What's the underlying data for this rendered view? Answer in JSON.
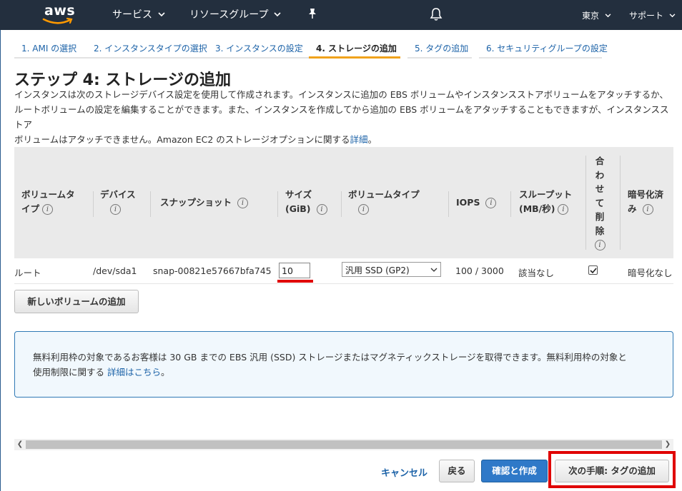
{
  "topnav": {
    "logo_text": "aws",
    "services_label": "サービス",
    "resource_groups_label": "リソースグループ",
    "region_label": "東京",
    "support_label": "サポート",
    "icons": [
      "pin-icon",
      "bell-icon",
      "chevron-down-icon"
    ]
  },
  "wizard": {
    "tabs": [
      {
        "label": "1. AMI の選択"
      },
      {
        "label": "2. インスタンスタイプの選択"
      },
      {
        "label": "3. インスタンスの設定"
      },
      {
        "label": "4. ストレージの追加",
        "active": true
      },
      {
        "label": "5. タグの追加"
      },
      {
        "label": "6. セキュリティグループの設定"
      }
    ]
  },
  "page": {
    "title": "ステップ 4: ストレージの追加",
    "description_line1": "インスタンスは次のストレージデバイス設定を使用して作成されます。インスタンスに追加の EBS ボリュームやインスタンスストアボリュームをアタッチするか、",
    "description_line2": "ルートボリュームの設定を編集することができます。また、インスタンスを作成してから追加の EBS ボリュームをアタッチすることもできますが、インスタンスストア",
    "description_line3": "ボリュームはアタッチできません。Amazon EC2 のストレージオプションに関する",
    "description_link": "詳細",
    "description_end": "。"
  },
  "storage_table": {
    "headers": {
      "volume_type": [
        "ボリュームタ",
        "イプ"
      ],
      "device": [
        "デバイス"
      ],
      "snapshot": [
        "スナップショット"
      ],
      "size": [
        "サイズ",
        "(GiB)"
      ],
      "volume_kind": [
        "ボリュームタイプ"
      ],
      "iops": [
        "IOPS"
      ],
      "throughput": [
        "スループット",
        "(MB/秒)"
      ],
      "delete_on_termination": [
        "合",
        "わ",
        "せ",
        "て",
        "削",
        "除"
      ],
      "encryption": [
        "暗号化済",
        "み"
      ]
    },
    "row": {
      "volume_type": "ルート",
      "device": "/dev/sda1",
      "snapshot": "snap-00821e57667bfa745",
      "size": "10",
      "volume_kind": "汎用 SSD (GP2)",
      "iops": "100 / 3000",
      "throughput": "該当なし",
      "delete_on_termination": true,
      "encryption": "暗号化なし"
    },
    "add_volume_label": "新しいボリュームの追加"
  },
  "info_box": {
    "text_line1": "無料利用枠の対象であるお客様は 30 GB までの EBS 汎用 (SSD) ストレージまたはマグネティックストレージを取得できます。無料利用枠の対象と",
    "text_line2": "使用制限に関する",
    "link": "詳細はこちら",
    "text_end": "。"
  },
  "footer": {
    "cancel_label": "キャンセル",
    "back_label": "戻る",
    "review_label": "確認と作成",
    "next_label": "次の手順: タグの追加"
  },
  "colors": {
    "nav_bg": "#232f3e",
    "link": "#1d63a8",
    "primary_button": "#2f79c8",
    "active_tab_underline": "#f0a21b",
    "highlight": "#e00000"
  }
}
